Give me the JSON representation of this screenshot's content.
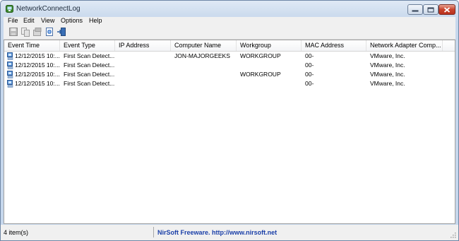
{
  "window": {
    "title": "NetworkConnectLog"
  },
  "menu": [
    "File",
    "Edit",
    "View",
    "Options",
    "Help"
  ],
  "toolbar": {
    "buttons": [
      "save-icon",
      "copy-icon",
      "properties-icon",
      "html-report-icon",
      "exit-icon"
    ]
  },
  "columns": [
    "Event Time",
    "Event Type",
    "IP Address",
    "Computer Name",
    "Workgroup",
    "MAC Address",
    "Network Adapter Comp..."
  ],
  "rows": [
    [
      "12/12/2015 10:...",
      "First Scan Detect...",
      "",
      "JON-MAJORGEEKS",
      "WORKGROUP",
      "00-",
      "VMware, Inc."
    ],
    [
      "12/12/2015 10:...",
      "First Scan Detect...",
      "",
      "",
      "",
      "00-",
      "VMware, Inc."
    ],
    [
      "12/12/2015 10:...",
      "First Scan Detect...",
      "",
      "",
      "WORKGROUP",
      "00-",
      "VMware, Inc."
    ],
    [
      "12/12/2015 10:...",
      "First Scan Detect...",
      "",
      "",
      "",
      "00-",
      "VMware, Inc."
    ]
  ],
  "status": {
    "count": "4 item(s)",
    "link": "NirSoft Freeware.  http://www.nirsoft.net"
  }
}
